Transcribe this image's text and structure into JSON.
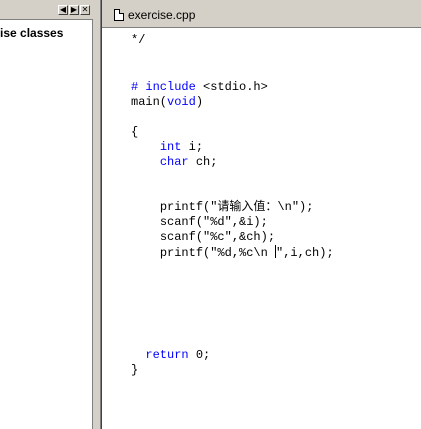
{
  "left_panel": {
    "item": "ise classes",
    "scroll_left": "◀",
    "scroll_right": "▶",
    "close": "✕"
  },
  "editor": {
    "tab_title": "exercise.cpp",
    "code": [
      {
        "parts": [
          {
            "t": "*/"
          }
        ],
        "indent": "",
        "top": 0
      },
      {
        "parts": [
          {
            "t": "# include ",
            "k": true
          },
          {
            "t": "<stdio.h>"
          }
        ],
        "indent": "",
        "top": 0
      },
      {
        "parts": [
          {
            "t": "main("
          },
          {
            "t": "void",
            "k": true
          },
          {
            "t": ")"
          }
        ],
        "indent": "",
        "top": 0
      },
      {
        "parts": [
          {
            "t": "{"
          }
        ],
        "indent": "",
        "top": 0
      },
      {
        "parts": [
          {
            "t": "int",
            "k": true
          },
          {
            "t": " i;"
          }
        ],
        "indent": "    ",
        "top": 0
      },
      {
        "parts": [
          {
            "t": "char",
            "k": true
          },
          {
            "t": " ch;"
          }
        ],
        "indent": "    ",
        "top": 0
      },
      {
        "parts": [
          {
            "t": "printf(\"请输入值：\\n\");"
          }
        ],
        "indent": "    ",
        "top": 0
      },
      {
        "parts": [
          {
            "t": "scanf(\"%d\",&i);"
          }
        ],
        "indent": "    ",
        "top": 0
      },
      {
        "parts": [
          {
            "t": "scanf(\"%c\",&ch);"
          }
        ],
        "indent": "    ",
        "top": 0
      },
      {
        "parts": [
          {
            "t": "printf(\"%d,%c\\n \",i,ch);"
          }
        ],
        "indent": "    ",
        "top": 0
      },
      {
        "parts": [
          {
            "t": "return",
            "k": true
          },
          {
            "t": " 0;"
          }
        ],
        "indent": "  ",
        "top": 0
      },
      {
        "parts": [
          {
            "t": "}"
          }
        ],
        "indent": "",
        "top": 0
      }
    ]
  }
}
